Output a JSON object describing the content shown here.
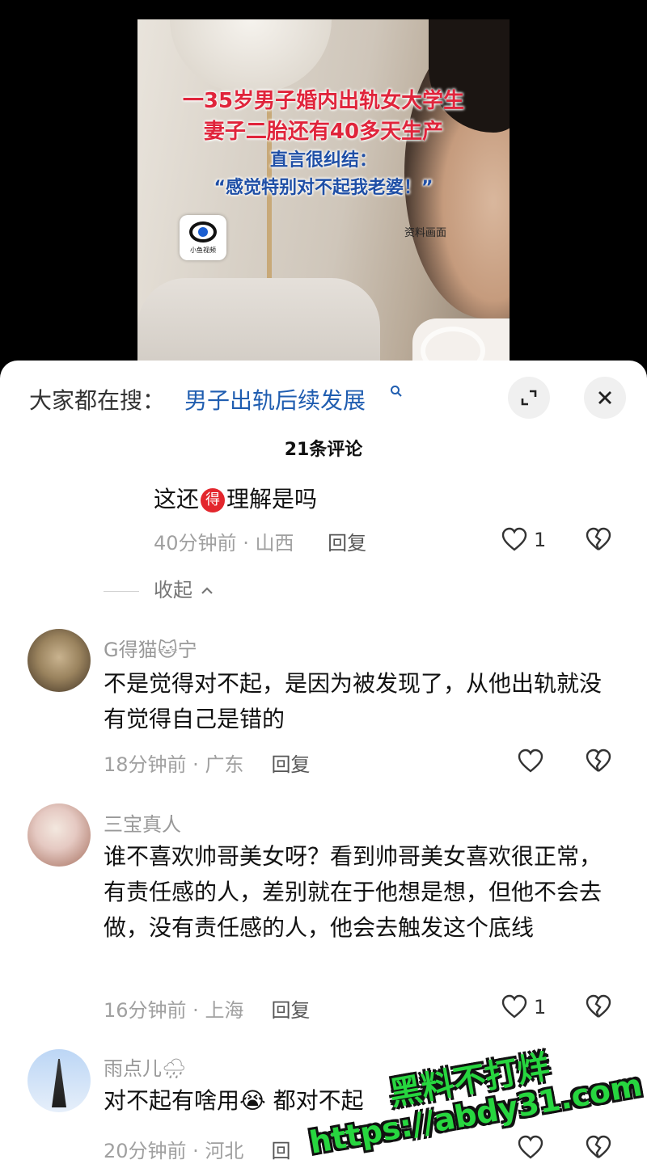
{
  "video": {
    "caption_line1": "一35岁男子婚内出轨女大学生",
    "caption_line2": "妻子二胎还有40多天生产",
    "caption_line3": "直言很纠结：",
    "caption_line4": "“感觉特别对不起我老婆！”",
    "source_note": "资料画面",
    "logo_text": "小鱼视频"
  },
  "search": {
    "label": "大家都在搜：",
    "term": "男子出轨后续发展"
  },
  "comments_count": "21条评论",
  "reply": {
    "text_before": "这还",
    "badge": "得",
    "text_after": "理解是吗",
    "time": "40分钟前",
    "location": "山西",
    "reply_label": "回复",
    "likes": "1"
  },
  "collapse_label": "收起",
  "comments": [
    {
      "username": "G得猫🐱宁",
      "text": "不是觉得对不起，是因为被发现了，从他出轨就没有觉得自己是错的",
      "time": "18分钟前",
      "location": "广东",
      "reply_label": "回复",
      "likes": ""
    },
    {
      "username": "三宝真人",
      "text": "谁不喜欢帅哥美女呀？看到帅哥美女喜欢很正常，有责任感的人，差别就在于他想是想，但他不会去做，没有责任感的人，他会去触发这个底线",
      "time": "16分钟前",
      "location": "上海",
      "reply_label": "回复",
      "likes": "1"
    },
    {
      "username": "雨点儿🌧",
      "text": "对不起有啥用😭 都对不起",
      "time": "20分钟前",
      "location": "河北",
      "reply_label": "回",
      "likes": ""
    }
  ],
  "watermark": {
    "line1": "黑料不打烊",
    "line2": "https://abdy31.com"
  }
}
